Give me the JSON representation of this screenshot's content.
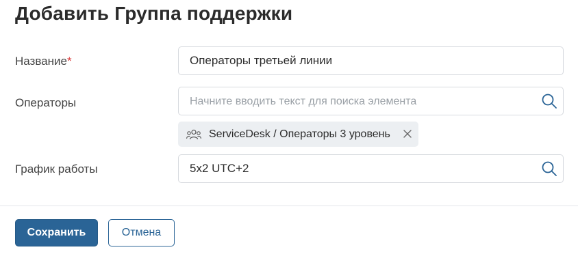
{
  "dialog": {
    "title": "Добавить Группа поддержки"
  },
  "form": {
    "name": {
      "label": "Название",
      "required_mark": "*",
      "value": "Операторы третьей линии"
    },
    "operators": {
      "label": "Операторы",
      "placeholder": "Начните вводить текст для поиска элемента",
      "value": "",
      "search_icon": "search-icon",
      "selected": [
        {
          "label": "ServiceDesk / Операторы 3 уровень",
          "icon": "group-icon",
          "remove_icon": "close-icon"
        }
      ]
    },
    "schedule": {
      "label": "График работы",
      "value": "5x2 UTC+2",
      "search_icon": "search-icon"
    }
  },
  "actions": {
    "save_label": "Сохранить",
    "cancel_label": "Отмена"
  },
  "colors": {
    "primary": "#2a6496",
    "required": "#d93636",
    "chip_bg": "#eceff2",
    "border": "#d6d9de"
  }
}
